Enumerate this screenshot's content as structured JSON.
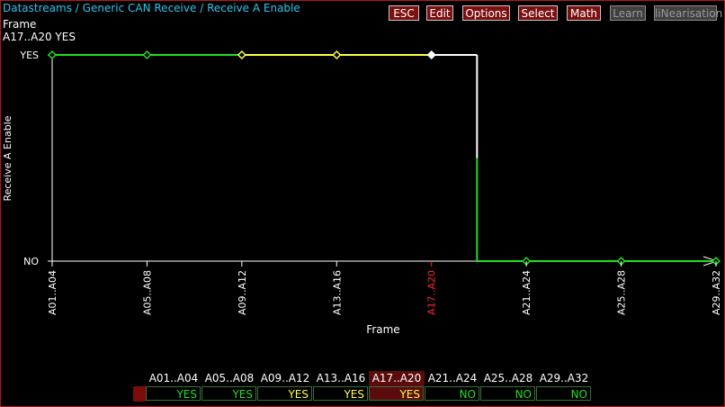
{
  "breadcrumb": [
    "Datastreams",
    "Generic CAN Receive",
    "Receive A Enable"
  ],
  "info": {
    "label": "Frame",
    "value": "A17..A20   YES"
  },
  "toolbar": [
    {
      "label": "ESC",
      "enabled": true
    },
    {
      "label": "Edit",
      "enabled": true
    },
    {
      "label": "Options",
      "enabled": true
    },
    {
      "label": "Select",
      "enabled": true
    },
    {
      "label": "Math",
      "enabled": true
    },
    {
      "label": "Learn",
      "enabled": false
    },
    {
      "label": "liNearisation",
      "enabled": false
    }
  ],
  "colors": {
    "accent": "#b01818",
    "breadcrumb": "#29c6f0",
    "green": "#22dd22",
    "yellow": "#ffff44",
    "current": "#ff2a2a"
  },
  "chart_data": {
    "type": "line",
    "title": "",
    "xlabel": "Frame",
    "ylabel": "Receive A Enable",
    "y_ticks": [
      "YES",
      "NO"
    ],
    "categories": [
      "A01..A04",
      "A05..A08",
      "A09..A12",
      "A13..A16",
      "A17..A20",
      "A21..A24",
      "A25..A28",
      "A29..A32"
    ],
    "values": [
      "YES",
      "YES",
      "YES",
      "YES",
      "YES",
      "NO",
      "NO",
      "NO"
    ],
    "point_colors": [
      "green",
      "green",
      "yellow",
      "yellow",
      "white",
      "green",
      "green",
      "green"
    ],
    "current_index": 4
  },
  "table": {
    "headers": [
      "A01..A04",
      "A05..A08",
      "A09..A12",
      "A13..A16",
      "A17..A20",
      "A21..A24",
      "A25..A28",
      "A29..A32"
    ],
    "values": [
      "YES",
      "YES",
      "YES",
      "YES",
      "YES",
      "NO",
      "NO",
      "NO"
    ],
    "value_colors": [
      "green",
      "green",
      "yellow",
      "yellow",
      "yellow",
      "green",
      "green",
      "green"
    ],
    "current_index": 4
  }
}
